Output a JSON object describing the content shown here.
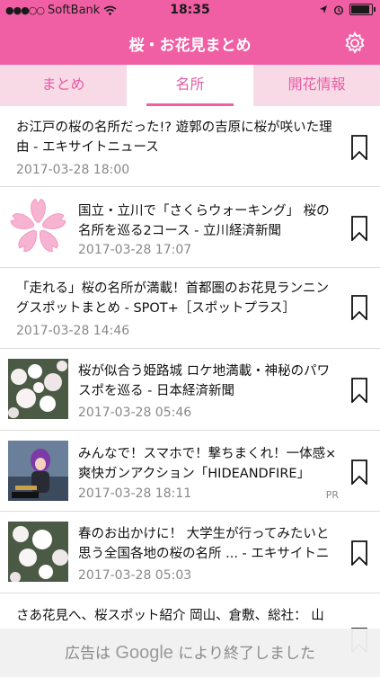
{
  "status": {
    "carrier": "SoftBank",
    "time": "18:35"
  },
  "nav": {
    "title": "桜・お花見まとめ"
  },
  "tabs": [
    {
      "label": "まとめ"
    },
    {
      "label": "名所"
    },
    {
      "label": "開花情報"
    }
  ],
  "articles": [
    {
      "title_line1": "お江戸の桜の名所だった!? 遊郭の吉原に桜が咲いた理",
      "title_line2": "由 - エキサイトニュース",
      "date": "2017-03-28 18:00"
    },
    {
      "title_line1": "国立・立川で「さくらウォーキング」 桜の",
      "title_line2": "名所を巡る2コース - 立川経済新聞",
      "date": "2017-03-28 17:07"
    },
    {
      "title_line1": "「走れる」桜の名所が満載！首都圏のお花見ランニン",
      "title_line2": "グスポットまとめ - SPOT+［スポットプラス］",
      "date": "2017-03-28 14:46"
    },
    {
      "title_line1": "桜が似合う姫路城 ロケ地満載・神秘のパワ",
      "title_line2": "スポを巡る - 日本経済新聞",
      "date": "2017-03-28 05:46"
    },
    {
      "title_line1": "みんなで！スマホで！撃ちまくれ！一体感×",
      "title_line2": "爽快ガンアクション「HIDEANDFIRE」",
      "date": "2017-03-28 18:11",
      "badge": "PR"
    },
    {
      "title_line1": "春のお出かけに！ 大学生が行ってみたいと",
      "title_line2": "思う全国各地の桜の名所 ... - エキサイトニ",
      "date": "2017-03-28 05:03"
    },
    {
      "title_line1": "さあ花見へ、桜スポット紹介 岡山、倉敷、総社： 山"
    }
  ],
  "ad": {
    "prefix": "広告は",
    "brand": "Google",
    "suffix": "により終了しました"
  },
  "colors": {
    "accent": "#f05fa4",
    "tab_bg": "#f8d9e6"
  },
  "icons": [
    "wifi-icon",
    "location-icon",
    "alarm-icon",
    "battery-icon",
    "gear-icon",
    "bookmark-icon",
    "sakura-flower-icon"
  ]
}
